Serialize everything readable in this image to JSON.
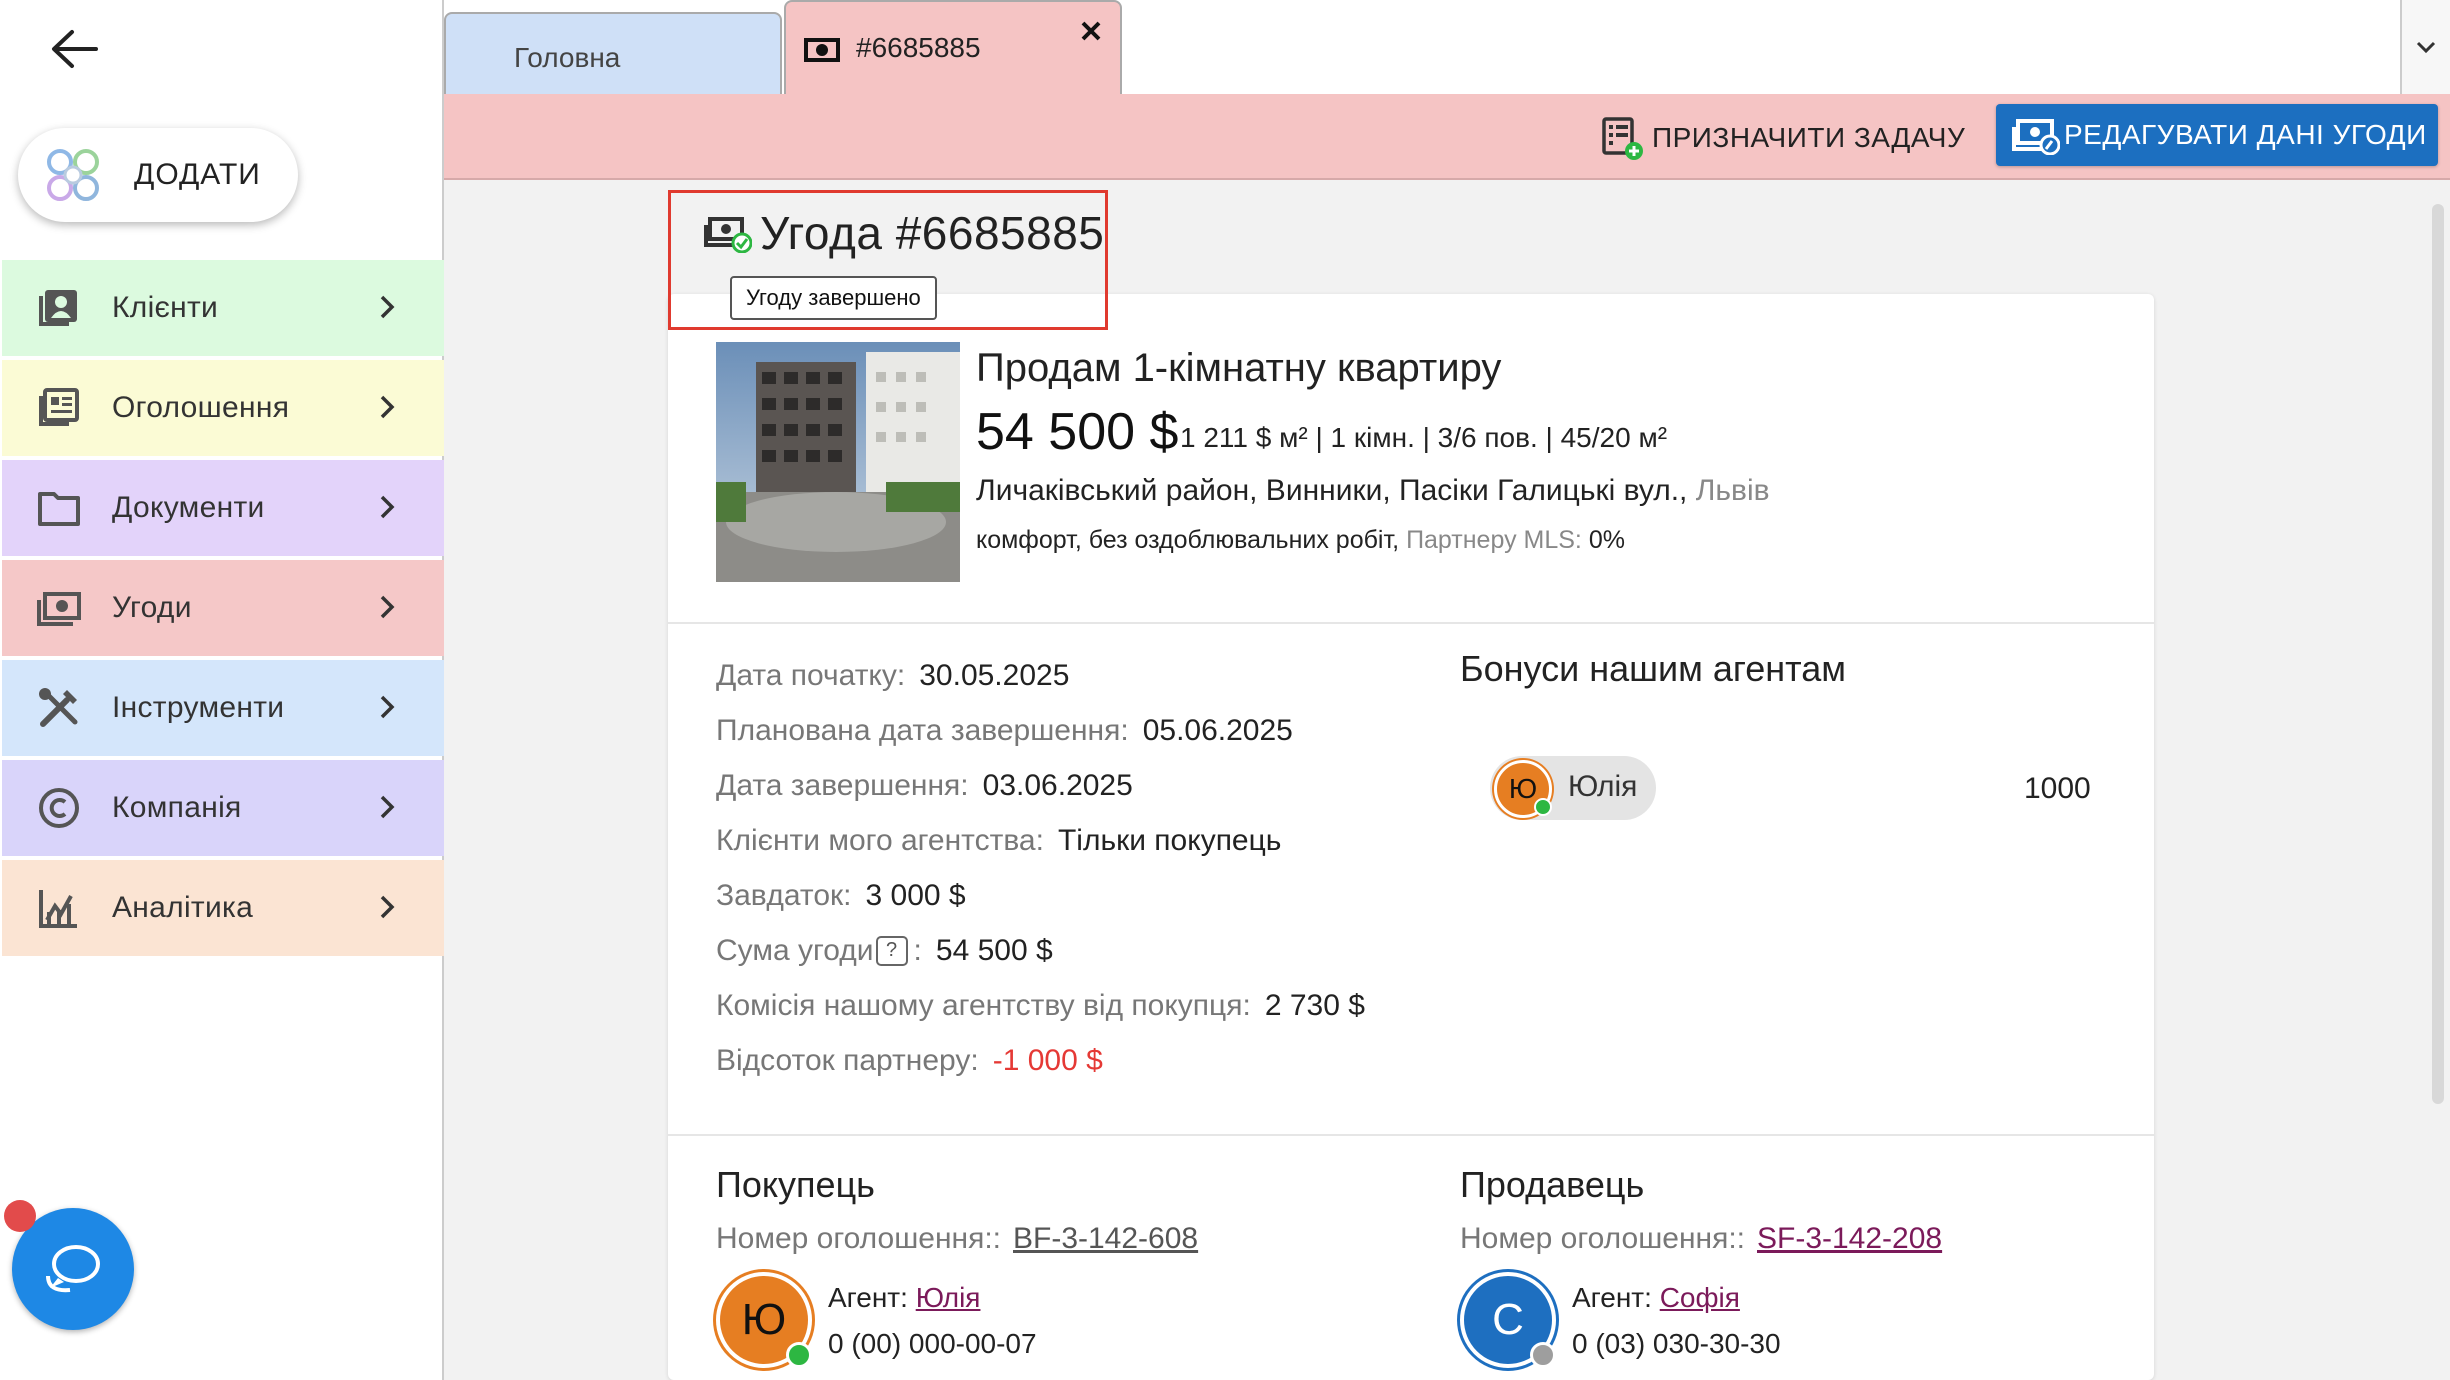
{
  "sidebar": {
    "add_label": "ДОДАТИ",
    "items": [
      {
        "label": "Клієнти",
        "icon": "contacts-icon",
        "color": "#dcfadf"
      },
      {
        "label": "Оголошення",
        "icon": "listings-icon",
        "color": "#fbfbd5"
      },
      {
        "label": "Документи",
        "icon": "folder-icon",
        "color": "#e3d3fa"
      },
      {
        "label": "Угоди",
        "icon": "money-icon",
        "color": "#f5c8c8"
      },
      {
        "label": "Інструменти",
        "icon": "tools-icon",
        "color": "#d4e6fb"
      },
      {
        "label": "Компанія",
        "icon": "copyright-icon",
        "color": "#d9d4fa"
      },
      {
        "label": "Аналітика",
        "icon": "analytics-icon",
        "color": "#fbe4d3"
      }
    ]
  },
  "tabs": {
    "home_label": "Головна",
    "deal_label": "#6685885"
  },
  "actions": {
    "assign_label": "ПРИЗНАЧИТИ ЗАДАЧУ",
    "edit_label": "РЕДАГУВАТИ ДАНІ УГОДИ"
  },
  "deal": {
    "title": "Угода #6685885",
    "status_tooltip": "Угоду завершено"
  },
  "property": {
    "title": "Продам 1-кімнатну квартиру",
    "price": "54 500 $",
    "specs": "1 211 $ м² | 1 кімн. | 3/6 пов. | 45/20 м²",
    "address": "Личаківський район, Винники, Пасіки Галицькі вул.,",
    "city": "Львів",
    "features": "комфорт, без оздоблювальних робіт,",
    "mls_label": "Партнеру MLS:",
    "mls_value": "0%"
  },
  "info": [
    {
      "label": "Дата початку:",
      "value": "30.05.2025"
    },
    {
      "label": "Планована дата завершення:",
      "value": "05.06.2025"
    },
    {
      "label": "Дата завершення:",
      "value": "03.06.2025"
    },
    {
      "label": "Клієнти мого агентства:",
      "value": "Тільки покупець"
    },
    {
      "label": "Завдаток:",
      "value": "3 000 $"
    },
    {
      "label": "Сума угоди",
      "value": "54 500 $"
    },
    {
      "label": "Комісія нашому агентству від покупця:",
      "value": "2 730 $"
    },
    {
      "label": "Відсоток партнеру:",
      "value": "-1 000 $"
    }
  ],
  "bonuses": {
    "title": "Бонуси нашим агентам",
    "agent_initial": "Ю",
    "agent_name": "Юлія",
    "amount": "1000"
  },
  "buyer": {
    "title": "Покупець",
    "listing_label": "Номер оголошення::",
    "listing_id": "BF-3-142-608",
    "initial": "Ю",
    "agent_label": "Агент:",
    "agent_name": "Юлія",
    "phone": "0 (00) 000-00-07"
  },
  "seller": {
    "title": "Продавець",
    "listing_label": "Номер оголошення::",
    "listing_id": "SF-3-142-208",
    "initial": "С",
    "agent_label": "Агент:",
    "agent_name": "Софія",
    "phone": "0 (03) 030-30-30"
  },
  "colors": {
    "accent": "#1c6fc0",
    "deal_tab": "#f5c4c4",
    "negative": "#e53935",
    "highlight_box": "#e03a2f"
  }
}
